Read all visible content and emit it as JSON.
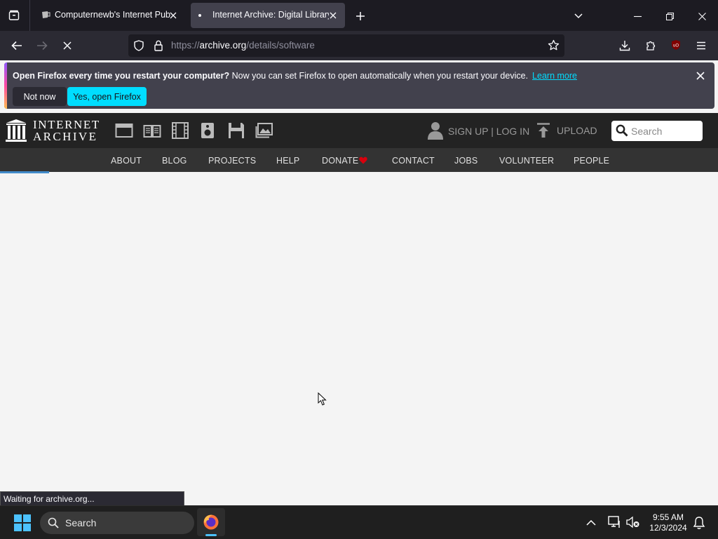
{
  "browser": {
    "tabs": [
      {
        "title": "Computernewb's Internet Pub | ",
        "active": false
      },
      {
        "title": "Internet Archive: Digital Library",
        "active": true
      }
    ],
    "url_prefix": "https://",
    "url_host": "archive.org",
    "url_path": "/details/software"
  },
  "notification": {
    "bold": "Open Firefox every time you restart your computer?",
    "text": "Now you can set Firefox to open automatically when you restart your device.",
    "learn_more": "Learn more",
    "not_now": "Not now",
    "yes": "Yes, open Firefox"
  },
  "ia": {
    "logo_line1": "INTERNET",
    "logo_line2": "ARCHIVE",
    "signup": "SIGN UP | LOG IN",
    "upload": "UPLOAD",
    "search_placeholder": "Search",
    "nav": [
      "ABOUT",
      "BLOG",
      "PROJECTS",
      "HELP",
      "DONATE",
      "CONTACT",
      "JOBS",
      "VOLUNTEER",
      "PEOPLE"
    ]
  },
  "status": "Waiting for archive.org...",
  "taskbar": {
    "search": "Search",
    "time": "9:55 AM",
    "date": "12/3/2024"
  },
  "colors": {
    "firefox_accent": "#00ddff",
    "donate_heart": "#d9000d",
    "ia_header": "#232323"
  }
}
